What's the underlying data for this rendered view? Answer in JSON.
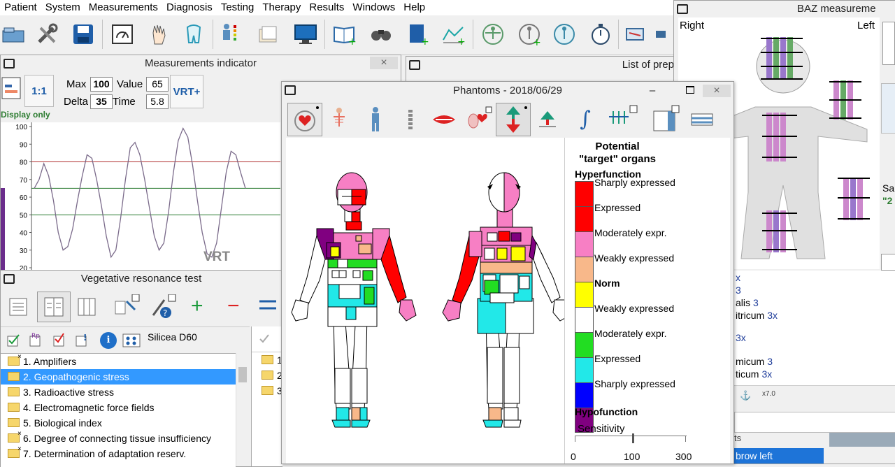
{
  "menu": [
    "Patient",
    "System",
    "Measurements",
    "Diagnosis",
    "Testing",
    "Therapy",
    "Results",
    "Windows",
    "Help"
  ],
  "measurements": {
    "title": "Measurements indicator",
    "ratio_label": "1:1",
    "max_label": "Max",
    "max_value": "100",
    "value_label": "Value",
    "value_value": "65",
    "delta_label": "Delta",
    "delta_value": "35",
    "time_label": "Time",
    "time_value": "5.8",
    "vrt_button": "VRT+",
    "display_only": "Display only",
    "chart_watermark": "VRT"
  },
  "chart_data": {
    "type": "line",
    "yticks": [
      "100",
      "90",
      "80",
      "70",
      "60",
      "50",
      "40",
      "30",
      "20"
    ],
    "ylim": [
      20,
      100
    ],
    "reference_lines": [
      80,
      65,
      50
    ],
    "reference_colors": [
      "#b03030",
      "#2e7d32",
      "#2e7d32"
    ],
    "series": [
      {
        "values": [
          65,
          70,
          79,
          72,
          58,
          40,
          30,
          32,
          42,
          58,
          72,
          84,
          82,
          70,
          55,
          38,
          26,
          30,
          48,
          70,
          88,
          91,
          84,
          70,
          54,
          38,
          30,
          34,
          52,
          74,
          92,
          99,
          94,
          78,
          58,
          40,
          28,
          26,
          34,
          54,
          74,
          86,
          84,
          74,
          65
        ]
      }
    ]
  },
  "vrt": {
    "title": "Vegetative resonance test",
    "remedy": "Silicea D60",
    "items": [
      {
        "label": "1. Amplifiers",
        "marked": true,
        "selected": false
      },
      {
        "label": "2. Geopathogenic stress",
        "marked": false,
        "selected": true
      },
      {
        "label": "3. Radioactive stress",
        "marked": false,
        "selected": false
      },
      {
        "label": "4. Electromagnetic force fields",
        "marked": false,
        "selected": false
      },
      {
        "label": "5. Biological index",
        "marked": false,
        "selected": false
      },
      {
        "label": "6. Degree of connecting tissue insufficiency",
        "marked": true,
        "selected": false
      },
      {
        "label": "7. Determination of adaptation reserv.",
        "marked": true,
        "selected": false
      }
    ],
    "right_items": [
      "1",
      "2",
      "3"
    ]
  },
  "prep": {
    "title": "List of prep"
  },
  "baz": {
    "title": "BAZ measureme",
    "right": "Right",
    "left": "Left",
    "side_text1": "Sa",
    "side_text2": "\"2",
    "partial_lines": [
      {
        "text": "x",
        "count": ""
      },
      {
        "text": "3",
        "count": ""
      },
      {
        "text": "alis",
        "count": "3"
      },
      {
        "text": "itricum",
        "count": "3x"
      },
      {
        "text": "3x",
        "count": ""
      },
      {
        "text": "micum",
        "count": "3"
      },
      {
        "text": "ticum",
        "count": "3x"
      }
    ],
    "zoom": "x7.0",
    "tab_ts": "ts",
    "arrow_left": "brow left"
  },
  "phantoms": {
    "title": "Phantoms - 2018/06/29",
    "legend_title_1": "Potential",
    "legend_title_2": "\"target\" organs",
    "hyperfunction": "Hyperfunction",
    "hypofunction": "Hypofunction",
    "norm": "Norm",
    "legend": [
      {
        "label": "Sharply expressed",
        "color": "#ff0000"
      },
      {
        "label": "Expressed",
        "color": "#ff0000"
      },
      {
        "label": "Moderately expr.",
        "color": "#f77fc4"
      },
      {
        "label": "Weakly expressed",
        "color": "#f8b88a"
      },
      {
        "label": "",
        "color": "#ffff00"
      },
      {
        "label": "Weakly expressed",
        "color": "#ffffff"
      },
      {
        "label": "Moderately expr.",
        "color": "#22dd22"
      },
      {
        "label": "Expressed",
        "color": "#22e8e8"
      },
      {
        "label": "Sharply expressed",
        "color": "#0000ff"
      }
    ],
    "legend_bottom_color": "#800080",
    "sensitivity_label": "Sensitivity",
    "sens_ticks": [
      "0",
      "100",
      "300"
    ]
  }
}
